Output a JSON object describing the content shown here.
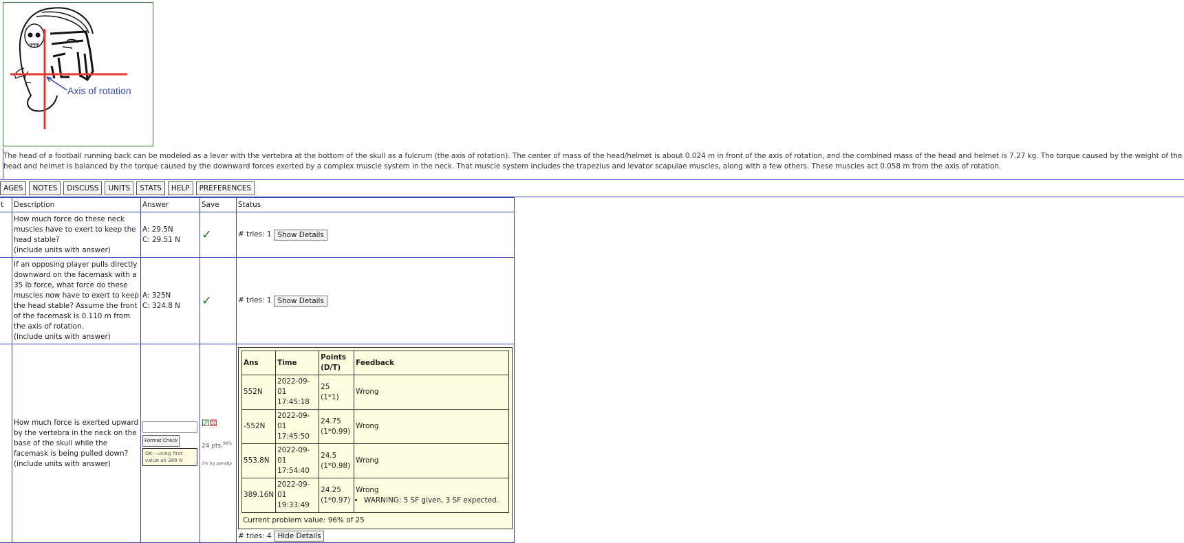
{
  "figure": {
    "caption": "Axis of rotation"
  },
  "intro_text": "The head of a football running back can be modeled as a lever with the vertebra at the bottom of the skull as a fulcrum (the axis of rotation). The center of mass of the head/helmet is about 0.024 m in front of the axis of rotation, and the combined mass of the head and helmet is 7.27 kg. The torque caused by the weight of the head and helmet is balanced by the torque caused by the downward forces exerted by a complex muscle system in the neck. That muscle system includes the trapezius and levator scapulae muscles, along with a few others. These muscles act 0.058 m from the axis of rotation.",
  "nav": [
    "AGES",
    "NOTES",
    "DISCUSS",
    "UNITS",
    "STATS",
    "HELP",
    "PREFERENCES"
  ],
  "table": {
    "headers": {
      "part": "t",
      "description": "Description",
      "answer": "Answer",
      "save": "Save",
      "status": "Status"
    },
    "rows": [
      {
        "description": "How much force do these neck muscles have to exert to keep the head stable?",
        "note": "(include units with answer)",
        "answer_a": "A: 29.5N",
        "answer_c": "C: 29.51 N",
        "save": "✓",
        "tries": "# tries: 1",
        "button": "Show Details"
      },
      {
        "description": "If an opposing player pulls directly downward on the facemask with a 35 lb force, what force do these muscles now have to exert to keep the head stable? Assume the front of the facemask is 0.110 m from the axis of rotation.",
        "note": "(include units with answer)",
        "answer_a": "A: 325N",
        "answer_c": "C: 324.8 N",
        "save": "✓",
        "tries": "# tries: 1",
        "button": "Show Details"
      },
      {
        "description": "How much force is exerted upward by the vertebra in the neck on the base of the skull while the facemask is being pulled down?",
        "note": "(include units with answer)",
        "answer_value": "",
        "format_check": "Format Check",
        "format_msg": "OK - using first value as 389 N",
        "points": "24 pts.",
        "points_pct": "96%",
        "penalty": "1% try penalty",
        "feedback": {
          "headers": {
            "ans": "Ans",
            "time": "Time",
            "points": "Points (D/T)",
            "feedback": "Feedback"
          },
          "rows": [
            {
              "ans": "552N",
              "date": "2022-09-01",
              "clock": "17:45:18",
              "pts": "25",
              "mult": "(1*1)",
              "fb": "Wrong",
              "warning": ""
            },
            {
              "ans": "-552N",
              "date": "2022-09-01",
              "clock": "17:45:50",
              "pts": "24.75",
              "mult": "(1*0.99)",
              "fb": "Wrong",
              "warning": ""
            },
            {
              "ans": "553.8N",
              "date": "2022-09-01",
              "clock": "17:54:40",
              "pts": "24.5",
              "mult": "(1*0.98)",
              "fb": "Wrong",
              "warning": ""
            },
            {
              "ans": "389.16N",
              "date": "2022-09-01",
              "clock": "19:33:49",
              "pts": "24.25",
              "mult": "(1*0.97)",
              "fb": "Wrong",
              "warning": "WARNING: 5 SF given, 3 SF expected."
            }
          ],
          "current_value": "Current problem value: 96% of 25"
        },
        "tries": "# tries: 4",
        "button": "Hide Details"
      }
    ]
  },
  "colors": {
    "border": "#3949ab",
    "check": "#1b7a1b",
    "axis": "#e53935",
    "caption": "#3446b8",
    "feedback_bg": "#fffde0"
  }
}
